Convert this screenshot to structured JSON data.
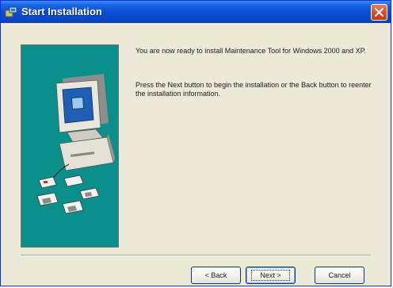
{
  "window": {
    "title": "Start Installation",
    "icon": "installer-icon",
    "close_icon": "close-icon"
  },
  "message": {
    "paragraph1": "You are now ready to install Maintenance Tool for Windows 2000 and XP.",
    "paragraph2": "Press the Next button to begin the installation or the Back button to reenter the installation information."
  },
  "buttons": {
    "back": "< Back",
    "next": "Next >",
    "cancel": "Cancel"
  },
  "colors": {
    "titlebar": "#0a4fd6",
    "side_panel": "#0b8f8a",
    "window_bg": "#ece9d8"
  }
}
